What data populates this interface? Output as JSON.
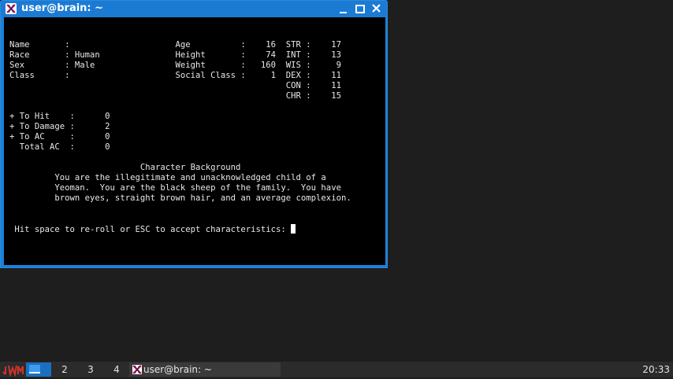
{
  "window": {
    "title": "user@brain: ~"
  },
  "terminal": {
    "lines": [
      "",
      "",
      "Name       :                     Age          :    16  STR :    17",
      "Race       : Human               Height       :    74  INT :    13",
      "Sex        : Male                Weight       :   160  WIS :     9",
      "Class      :                     Social Class :     1  DEX :    11",
      "                                                       CON :    11",
      "                                                       CHR :    15",
      "",
      "+ To Hit    :      0",
      "+ To Damage :      2",
      "+ To AC     :      0",
      "  Total AC  :      0",
      "",
      "                          Character Background",
      "         You are the illegitimate and unacknowledged child of a",
      "         Yeoman.  You are the black sheep of the family.  You have",
      "         brown eyes, straight brown hair, and an average complexion.",
      "",
      "",
      " Hit space to re-roll or ESC to accept characteristics: "
    ]
  },
  "taskbar": {
    "workspaces": [
      "1",
      "2",
      "3",
      "4"
    ],
    "active_workspace": "1",
    "task_title": "user@brain: ~",
    "clock": "20:33"
  },
  "colors": {
    "titlebar": "#1b7bd3",
    "terminal_bg": "#000000",
    "terminal_fg": "#e8e8e8",
    "taskbar_bg": "#2b2b2b",
    "workspace_active": "#1b6fbf"
  }
}
